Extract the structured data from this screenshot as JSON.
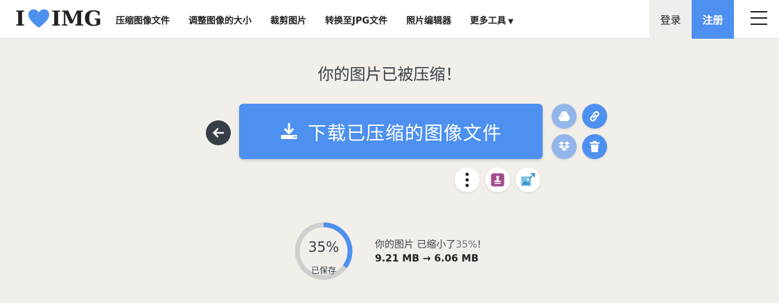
{
  "header": {
    "logo_left": "I",
    "logo_right": "IMG",
    "nav": [
      {
        "label": "压缩图像文件"
      },
      {
        "label": "调整图像的大小"
      },
      {
        "label": "裁剪图片"
      },
      {
        "label": "转换至JPG文件"
      },
      {
        "label": "照片编辑器"
      },
      {
        "label": "更多工具"
      }
    ],
    "login": "登录",
    "signup": "注册"
  },
  "main": {
    "title": "你的图片已被压缩！",
    "download_label": "下载已压缩的图像文件",
    "icons": {
      "back": "arrow-left-icon",
      "download": "download-icon",
      "drive": "google-drive-icon",
      "link": "link-icon",
      "dropbox": "dropbox-icon",
      "delete": "trash-icon",
      "more": "vertical-dots-icon",
      "stamp": "stamp-icon",
      "upscale": "image-upscale-icon"
    }
  },
  "stats": {
    "saved_percent": 35,
    "saved_percent_label": "35%",
    "saved_label": "已保存",
    "summary_prefix": "你的图片 已缩小了",
    "summary_pct": "35%",
    "summary_suffix": "!",
    "size_text": "9.21 MB → 6.06 MB"
  },
  "colors": {
    "accent": "#4d90f0",
    "accent_light": "#93b6ea",
    "background": "#f2efea",
    "dark": "#383e45"
  }
}
